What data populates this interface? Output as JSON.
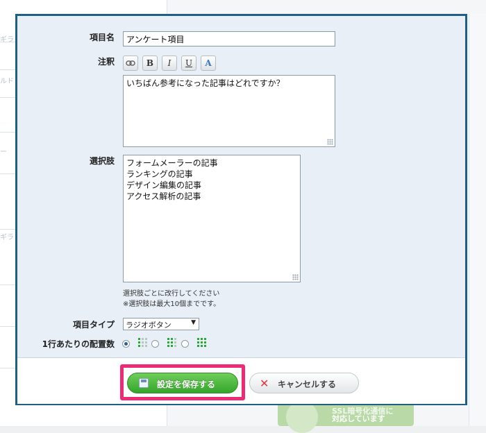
{
  "background": {
    "side_labels": [
      "ギラ",
      "ルド",
      "ー",
      "ギラ"
    ],
    "banner_line1": "SSL暗号化通信に",
    "banner_line2": "対応しています"
  },
  "form": {
    "item_name": {
      "label": "項目名",
      "value": "アンケート項目"
    },
    "note": {
      "label": "注釈",
      "toolbar": {
        "link": "link",
        "bold": "B",
        "italic": "I",
        "underline": "U",
        "color": "A"
      },
      "value": "いちばん参考になった記事はどれですか？"
    },
    "choices": {
      "label": "選択肢",
      "items": [
        "フォームメーラーの記事",
        "ランキングの記事",
        "デザイン編集の記事",
        "アクセス解析の記事"
      ],
      "hint1": "選択肢ごとに改行してください",
      "hint2": "※選択肢は最大10個までです。"
    },
    "item_type": {
      "label": "項目タイプ",
      "selected": "ラジオボタン"
    },
    "layout": {
      "label": "1行あたりの配置数",
      "selected_index": 0
    }
  },
  "footer": {
    "save_label": "設定を保存する",
    "cancel_label": "キャンセルする"
  },
  "colors": {
    "dialog_border": "#1e5f86",
    "highlight": "#ee2a74",
    "save_green": "#34a52a"
  }
}
